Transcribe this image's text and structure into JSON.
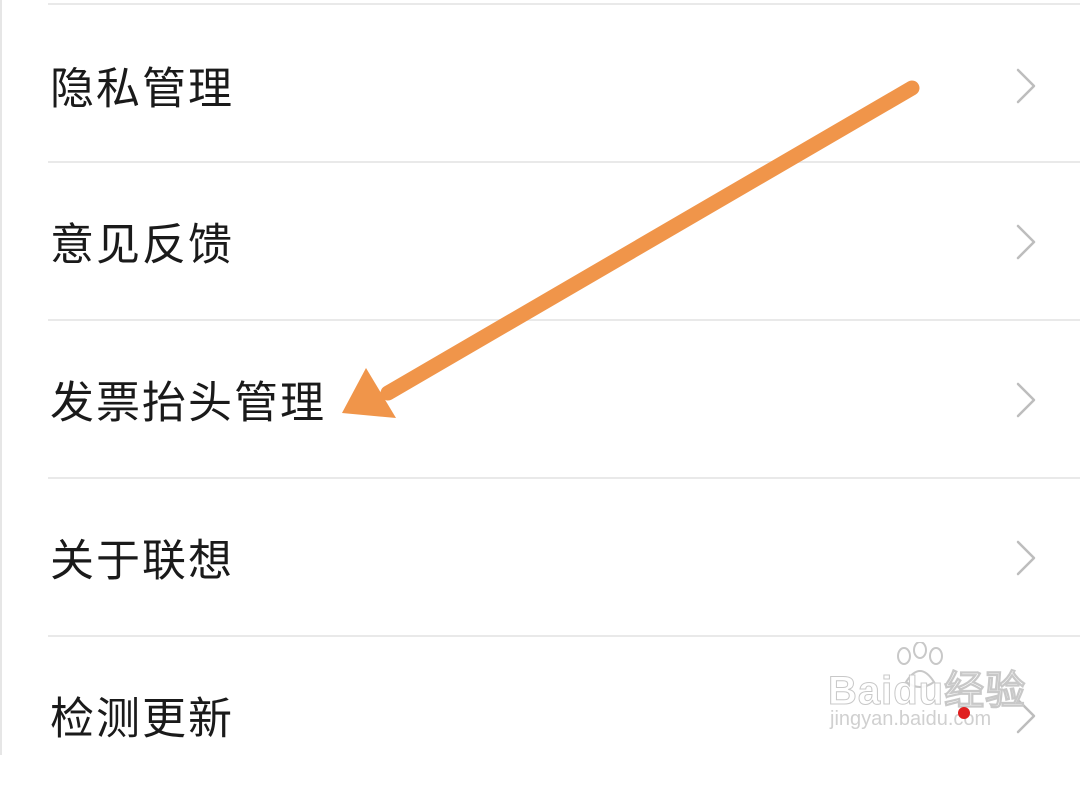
{
  "menu": {
    "items": [
      {
        "label": "隐私管理"
      },
      {
        "label": "意见反馈"
      },
      {
        "label": "发票抬头管理"
      },
      {
        "label": "关于联想"
      },
      {
        "label": "检测更新"
      }
    ]
  },
  "watermark": {
    "logo": "Baidu经验",
    "url": "jingyan.baidu.com"
  },
  "annotation": {
    "type": "arrow",
    "color": "#f0954a",
    "points_to": "发票抬头管理"
  },
  "colors": {
    "text": "#1a1a1a",
    "divider": "#e9e9e9",
    "chevron": "#bdbdbd",
    "notification_dot": "#e02020"
  },
  "icons": {
    "chevron": "chevron-right-icon",
    "paw": "baidu-paw-icon"
  }
}
